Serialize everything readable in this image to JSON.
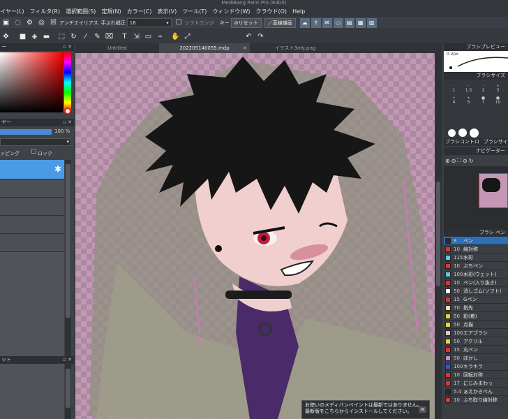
{
  "window": {
    "title": "MediBang Paint Pro (64bit)"
  },
  "menu": [
    "イヤー(L)",
    "フィルタ(R)",
    "選択範囲(S)",
    "定規(N)",
    "カラー(C)",
    "表示(V)",
    "ツール(T)",
    "ウィンドウ(W)",
    "クラウド(O)",
    "Help"
  ],
  "toolbar1": {
    "antialias": "アンチエイリアス",
    "stabilizer_label": "手ぶれ補正",
    "stabilizer_value": "16",
    "soft_edge": "ソフトエッジ",
    "key_label": "キー",
    "reset": "リセット",
    "direct_draw": "直線描画"
  },
  "tabs": [
    {
      "label": "Untitled"
    },
    {
      "label": "202205140055.mdp"
    },
    {
      "label": "イラスト3nhj.png"
    }
  ],
  "left": {
    "color_head": "ー",
    "layer_head": "ヤー",
    "opacity": "100 %",
    "clipping": "ッピング",
    "lock": "ロック",
    "bottom_head": "ット"
  },
  "right": {
    "brush_preview": "ブラシプレビュー",
    "brush_preview_value": "0.2px",
    "brush_size": "ブラシサイズ",
    "brush_size_labels": [
      "1",
      "1.5",
      "2",
      "3",
      "4",
      "5",
      "7",
      "10",
      "13"
    ],
    "brush_control": "ブラシコントロール",
    "brush_size2": "ブラシサイズ",
    "navigator": "ナビゲーター",
    "brush_list": "ブラシ ペン"
  },
  "brushes": [
    {
      "num": "8",
      "name": "ペン",
      "color": "#2a2a2a"
    },
    {
      "num": "10",
      "name": "線対称",
      "color": "#e83030"
    },
    {
      "num": "115",
      "name": "水彩",
      "color": "#6ac4ee"
    },
    {
      "num": "10",
      "name": "ぶちペン",
      "color": "#e83030"
    },
    {
      "num": "100",
      "name": "水彩(ウェット)",
      "color": "#6ac4ee"
    },
    {
      "num": "10",
      "name": "ペン(入り抜き)",
      "color": "#e83030"
    },
    {
      "num": "50",
      "name": "消しゴム(ソフト)",
      "color": "#ffffff"
    },
    {
      "num": "15",
      "name": "Gペン",
      "color": "#e83030"
    },
    {
      "num": "70",
      "name": "指先",
      "color": "#f0d8b0"
    },
    {
      "num": "50",
      "name": "鉛(着)",
      "color": "#f0d040"
    },
    {
      "num": "50",
      "name": "点描",
      "color": "#f0d040"
    },
    {
      "num": "100",
      "name": "エアブラシ",
      "color": "#cccccc"
    },
    {
      "num": "50",
      "name": "アクリル",
      "color": "#f0d040"
    },
    {
      "num": "15",
      "name": "丸ペン",
      "color": "#e83030"
    },
    {
      "num": "50",
      "name": "ぼかし",
      "color": "#cc88cc"
    },
    {
      "num": "100",
      "name": "キラキラ",
      "color": "#3355ee"
    },
    {
      "num": "10",
      "name": "回転対称",
      "color": "#e83030"
    },
    {
      "num": "17",
      "name": "にじみまわっ",
      "color": "#e83030"
    },
    {
      "num": "5.4",
      "name": "ぁえかきぺん",
      "color": "#2a2a2a"
    },
    {
      "num": "10",
      "name": "ふち取り線対称",
      "color": "#e83030"
    }
  ],
  "notice": {
    "line1": "お使いのメディバンペイントは最新ではありません。",
    "line2": "最新版をこちらからインストールしてください。"
  }
}
